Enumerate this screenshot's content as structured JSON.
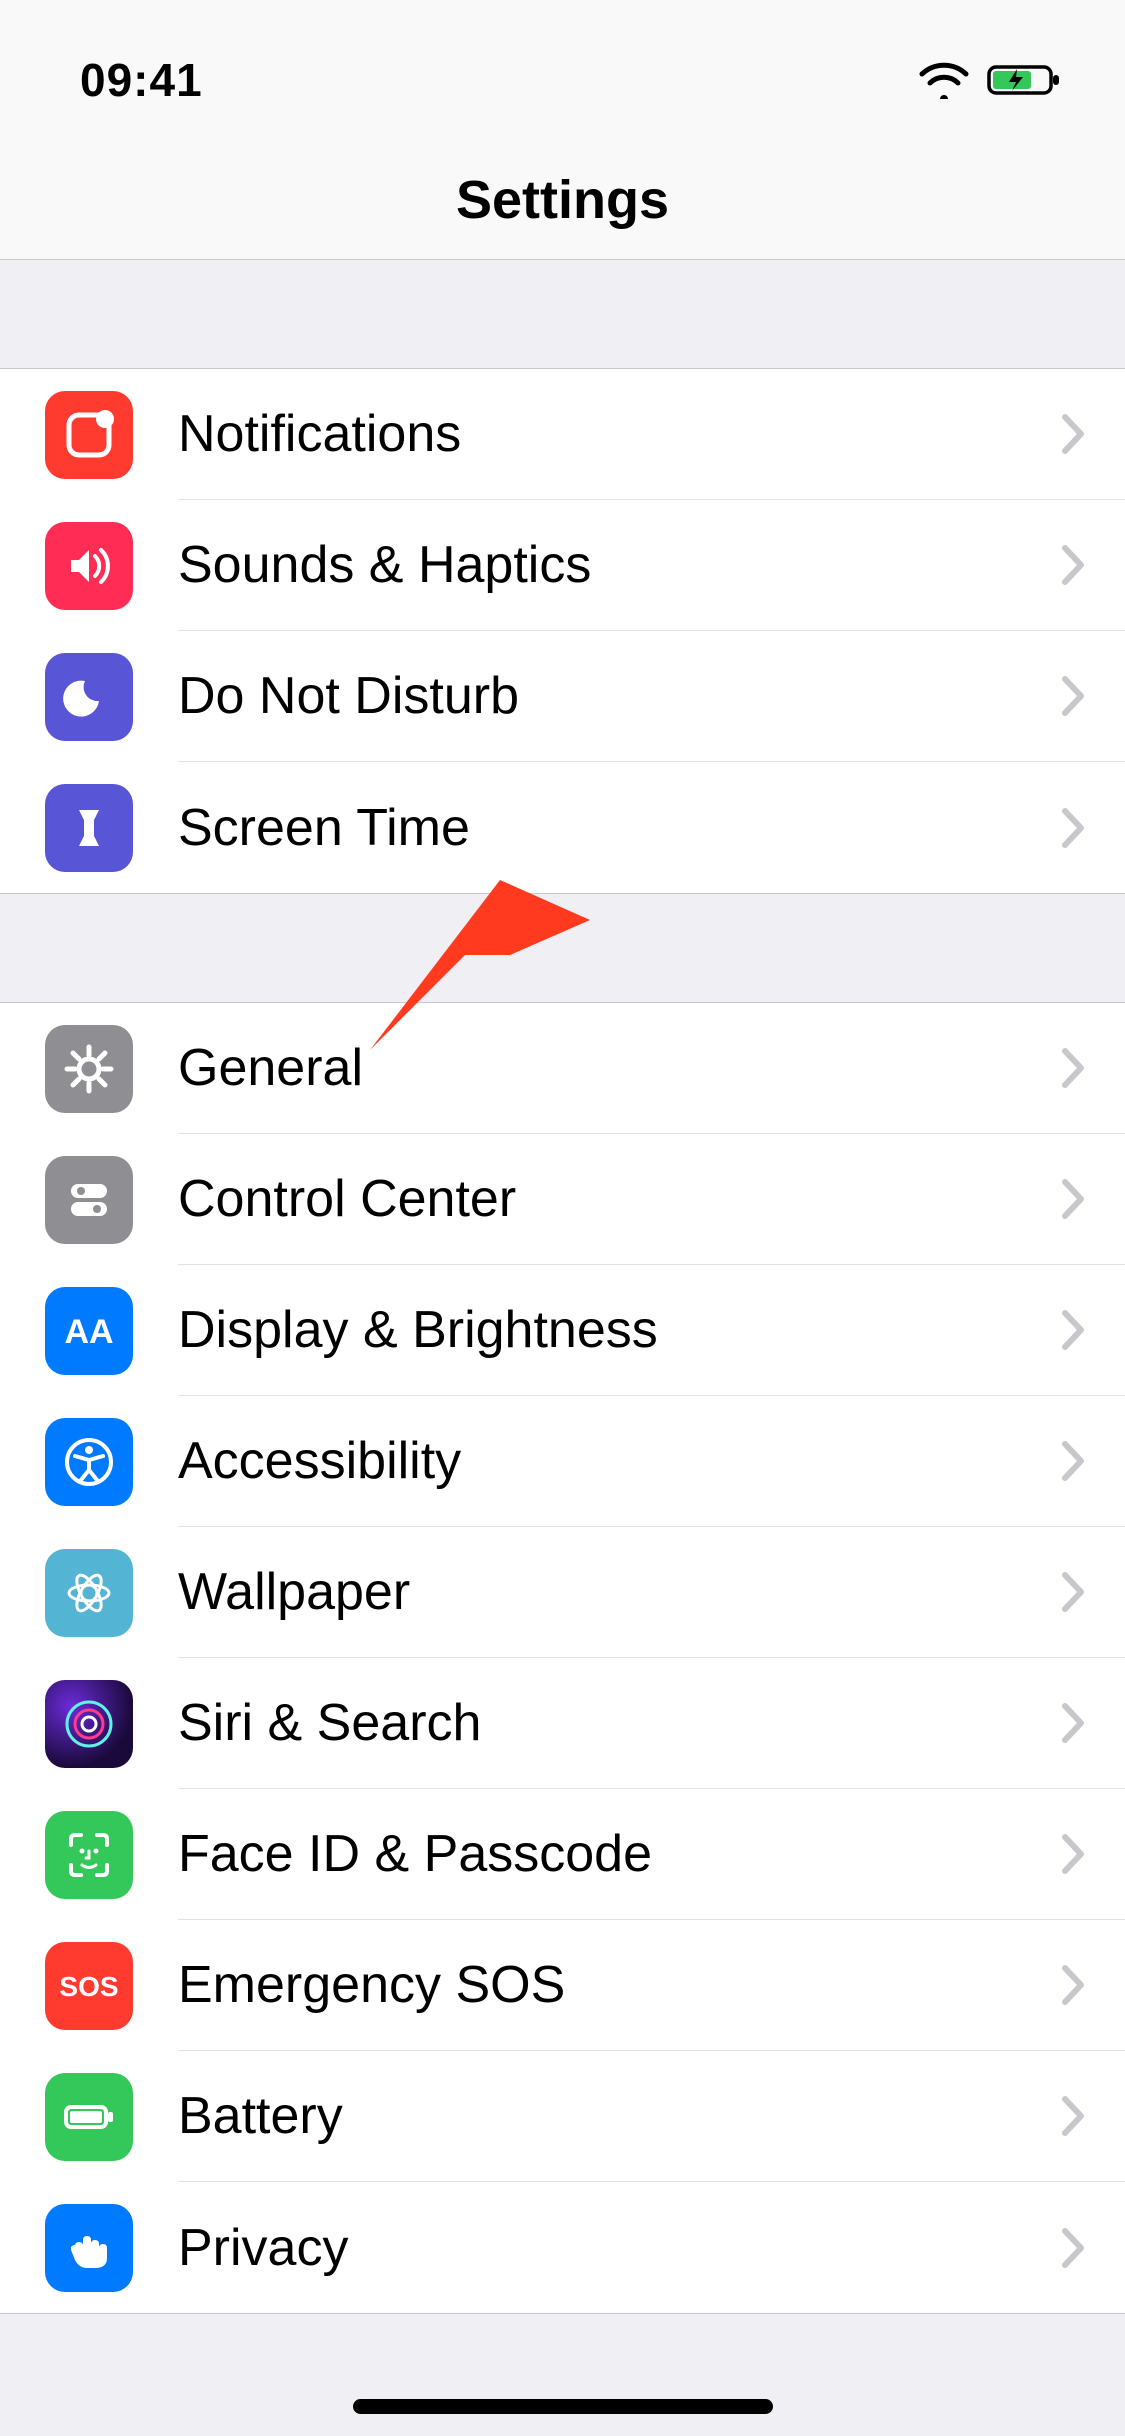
{
  "status": {
    "time": "09:41"
  },
  "header": {
    "title": "Settings"
  },
  "group1": [
    {
      "icon": "notifications-icon",
      "bg": "#ff3b30",
      "label": "Notifications"
    },
    {
      "icon": "sounds-icon",
      "bg": "#ff2d55",
      "label": "Sounds & Haptics"
    },
    {
      "icon": "do-not-disturb-icon",
      "bg": "#5856d6",
      "label": "Do Not Disturb"
    },
    {
      "icon": "screen-time-icon",
      "bg": "#5856d6",
      "label": "Screen Time"
    }
  ],
  "group2": [
    {
      "icon": "general-icon",
      "bg": "#8e8e93",
      "label": "General"
    },
    {
      "icon": "control-center-icon",
      "bg": "#8e8e93",
      "label": "Control Center"
    },
    {
      "icon": "display-icon",
      "bg": "#007aff",
      "label": "Display & Brightness"
    },
    {
      "icon": "accessibility-icon",
      "bg": "#007aff",
      "label": "Accessibility"
    },
    {
      "icon": "wallpaper-icon",
      "bg": "#54b4d3",
      "label": "Wallpaper"
    },
    {
      "icon": "siri-icon",
      "bg": "#000000",
      "label": "Siri & Search"
    },
    {
      "icon": "face-id-icon",
      "bg": "#34c759",
      "label": "Face ID & Passcode"
    },
    {
      "icon": "emergency-sos-icon",
      "bg": "#ff3b30",
      "label": "Emergency SOS",
      "text": "SOS"
    },
    {
      "icon": "battery-icon",
      "bg": "#34c759",
      "label": "Battery"
    },
    {
      "icon": "privacy-icon",
      "bg": "#007aff",
      "label": "Privacy"
    }
  ],
  "annotation": {
    "points_to": "General"
  }
}
